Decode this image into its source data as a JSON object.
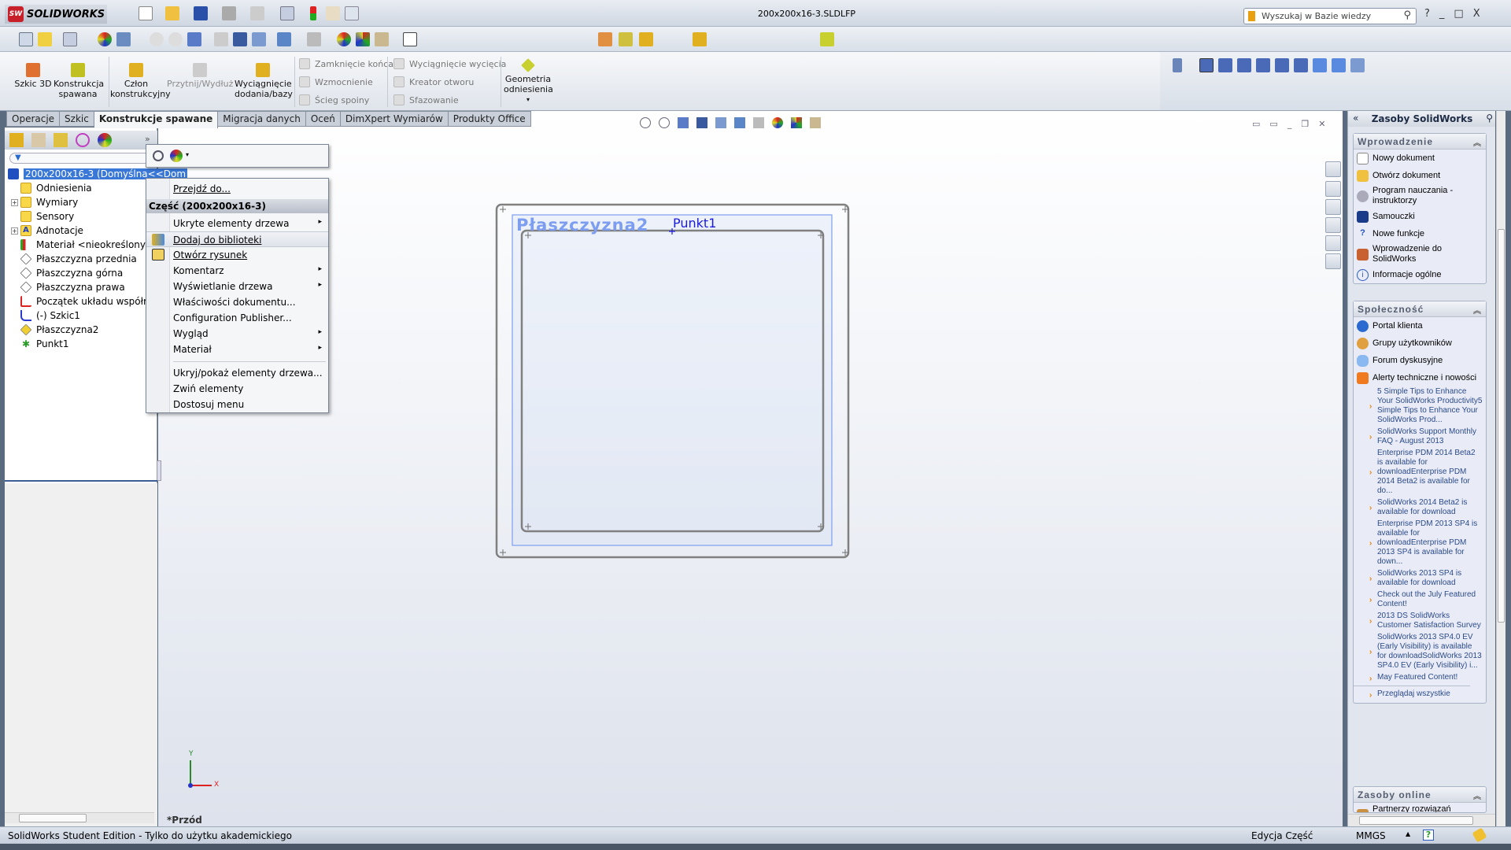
{
  "app": {
    "brand": "SOLIDWORKS",
    "document_title": "200x200x16-3.SLDLFP",
    "search_placeholder": "Wyszukaj w Bazie wiedzy",
    "help": "?",
    "minimize": "_",
    "restore": "□",
    "close": "X"
  },
  "ribbon": {
    "large": [
      {
        "label": "Szkic 3D"
      },
      {
        "label": "Konstrukcja spawana"
      },
      {
        "label": "Człon konstrukcyjny"
      },
      {
        "label": "Przytnij/Wydłuż"
      },
      {
        "label": "Wyciągnięcie dodania/bazy"
      },
      {
        "label": "Geometria odniesienia"
      }
    ],
    "small_col1": [
      "Zamknięcie końca",
      "Wzmocnienie",
      "Ścieg spoiny"
    ],
    "small_col2": [
      "Wyciągnięcie wycięcia",
      "Kreator otworu",
      "Sfazowanie"
    ]
  },
  "tabs": [
    "Operacje",
    "Szkic",
    "Konstrukcje spawane",
    "Migracja danych",
    "Oceń",
    "DimXpert Wymiarów",
    "Produkty Office"
  ],
  "active_tab": "Konstrukcje spawane",
  "tree": {
    "root": "200x200x16-3  (Domyślna<<Dom",
    "items": [
      "Odniesienia",
      "Wymiary",
      "Sensory",
      "Adnotacje",
      "Materiał <nieokreślony>",
      "Płaszczyzna przednia",
      "Płaszczyzna górna",
      "Płaszczyzna prawa",
      "Początek układu współrzę",
      "(-) Szkic1",
      "Płaszczyzna2",
      "Punkt1"
    ]
  },
  "context_menu": {
    "goto": "Przejdź do...",
    "header": "Część (200x200x16-3)",
    "items": [
      {
        "label": "Ukryte elementy drzewa",
        "submenu": true
      },
      {
        "label": "Dodaj do biblioteki"
      },
      {
        "label": "Otwórz rysunek"
      },
      {
        "label": "Komentarz",
        "submenu": true
      },
      {
        "label": "Wyświetlanie drzewa",
        "submenu": true
      },
      {
        "label": "Właściwości dokumentu..."
      },
      {
        "label": "Configuration Publisher..."
      },
      {
        "label": "Wygląd",
        "submenu": true
      },
      {
        "label": "Materiał",
        "submenu": true
      }
    ],
    "bottom_items": [
      "Ukryj/pokaż elementy drzewa...",
      "Zwiń elementy",
      "Dostosuj menu"
    ],
    "arrow": "▸"
  },
  "graphics": {
    "plane_label": "Płaszczyzna2",
    "point_label": "Punkt1",
    "view_name": "*Przód",
    "axis_x": "X",
    "axis_y": "Y"
  },
  "resources": {
    "title": "Zasoby SolidWorks",
    "collapse": "«",
    "intro": {
      "title": "Wprowadzenie",
      "items": [
        "Nowy dokument",
        "Otwórz dokument",
        "Program nauczania - instruktorzy",
        "Samouczki",
        "Nowe funkcje",
        "Wprowadzenie do SolidWorks",
        "Informacje ogólne"
      ]
    },
    "community": {
      "title": "Społeczność",
      "items": [
        "Portal klienta",
        "Grupy użytkowników",
        "Forum dyskusyjne",
        "Alerty techniczne i nowości"
      ]
    },
    "news": [
      "5 Simple Tips to Enhance Your SolidWorks Productivity5 Simple Tips to Enhance Your SolidWorks Prod...",
      "SolidWorks Support Monthly FAQ - August 2013",
      "Enterprise PDM 2014 Beta2 is available for downloadEnterprise PDM 2014 Beta2 is available for do...",
      "SolidWorks 2014 Beta2 is available for download",
      "Enterprise PDM 2013 SP4 is available for downloadEnterprise PDM 2013 SP4 is available for down...",
      "SolidWorks 2013 SP4 is available for download",
      "Check out the July Featured Content!",
      "2013 DS SolidWorks Customer Satisfaction Survey",
      "SolidWorks 2013 SP4.0 EV (Early Visibility) is available for downloadSolidWorks 2013 SP4.0 EV (Early Visibility) i...",
      "May Featured Content!"
    ],
    "browse_all": "Przeglądaj wszystkie",
    "online": {
      "title": "Zasoby online",
      "items": [
        "Partnerzy rozwiązań programowych"
      ]
    }
  },
  "status": {
    "edition": "SolidWorks Student Edition - Tylko do użytku akademickiego",
    "mode": "Edycja Część",
    "units": "MMGS"
  }
}
